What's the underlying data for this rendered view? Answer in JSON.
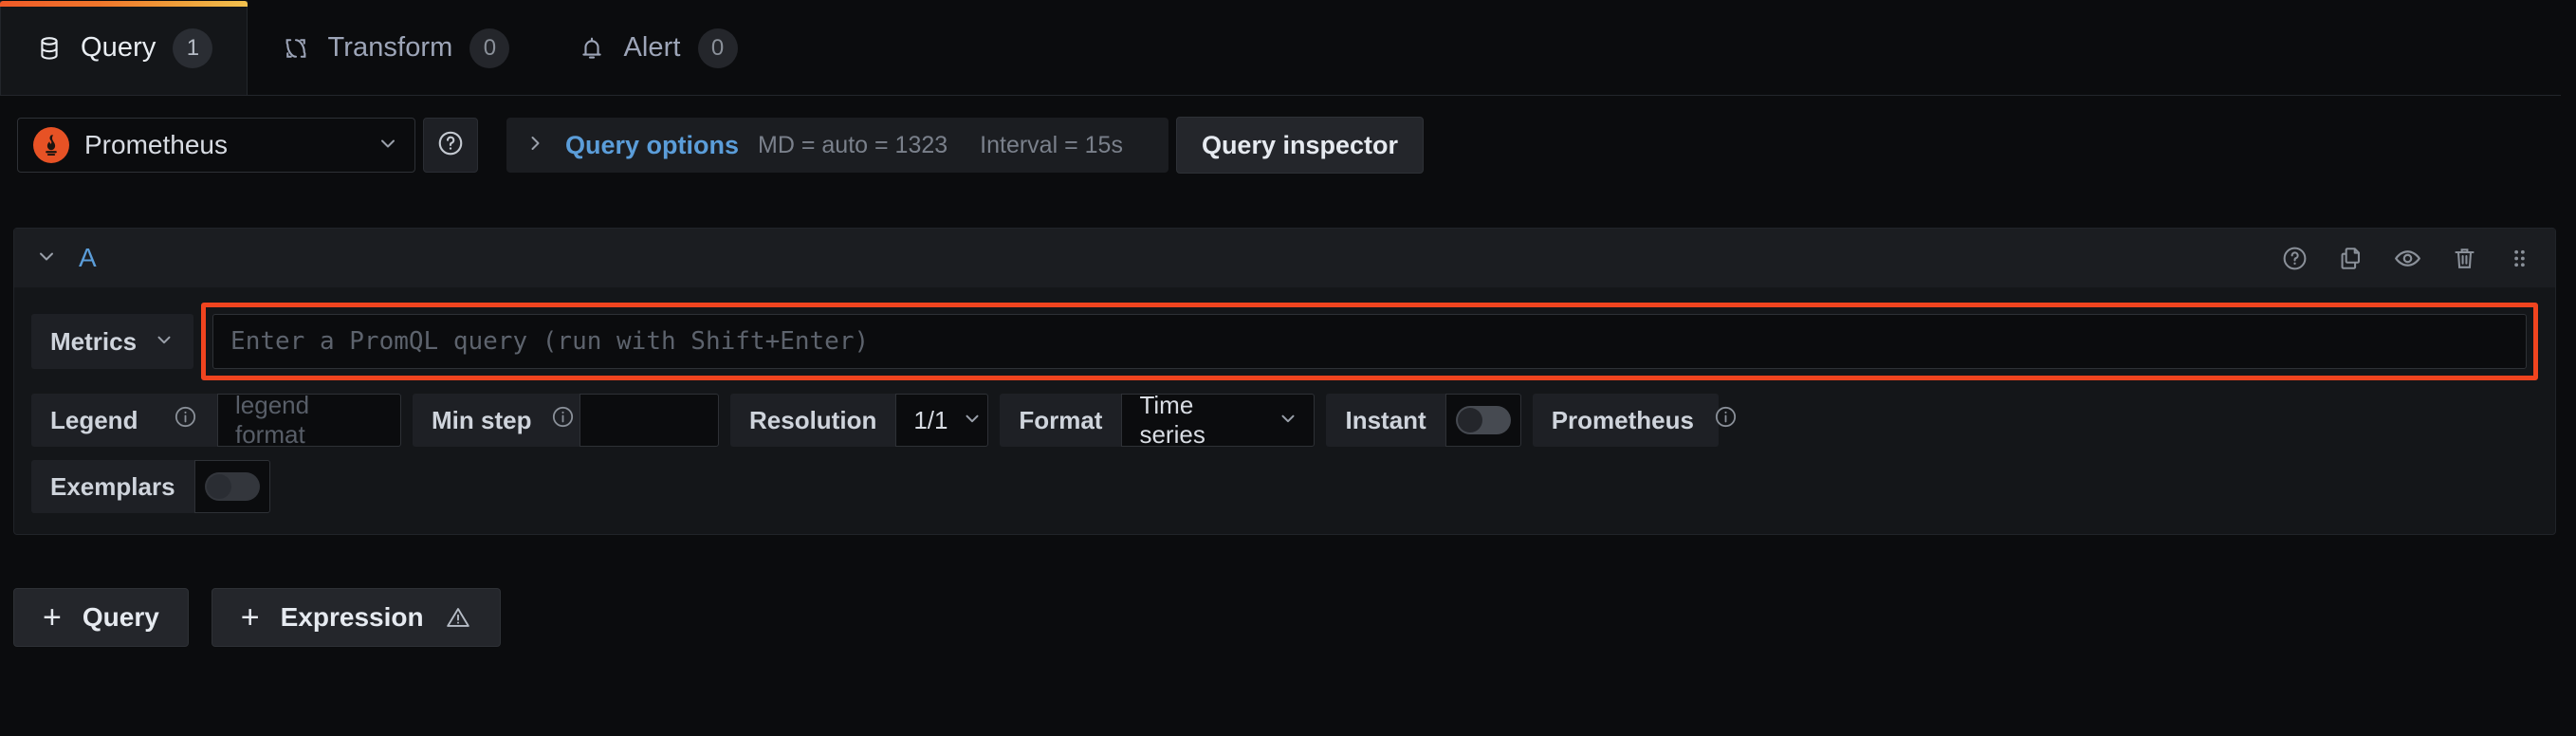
{
  "tabs": [
    {
      "label": "Query",
      "badge": "1",
      "icon": "database-icon",
      "active": true
    },
    {
      "label": "Transform",
      "badge": "0",
      "icon": "transform-icon",
      "active": false
    },
    {
      "label": "Alert",
      "badge": "0",
      "icon": "bell-icon",
      "active": false
    }
  ],
  "datasource": {
    "name": "Prometheus",
    "logo": "prometheus-logo",
    "help_icon": "help-circle-icon",
    "chevron": "chevron-down-icon"
  },
  "query_options": {
    "label": "Query options",
    "chevron": "chevron-right-icon",
    "max_data_points": "MD = auto = 1323",
    "interval": "Interval = 15s"
  },
  "query_inspector": {
    "label": "Query inspector"
  },
  "query_row": {
    "ref_id": "A",
    "collapse_icon": "chevron-down-icon",
    "actions": [
      {
        "name": "help-circle-icon",
        "title": "Show data source help"
      },
      {
        "name": "copy-icon",
        "title": "Duplicate query"
      },
      {
        "name": "eye-icon",
        "title": "Disable/enable query"
      },
      {
        "name": "trash-icon",
        "title": "Remove query"
      },
      {
        "name": "drag-handle-icon",
        "title": "Drag and drop to reorder"
      }
    ],
    "metrics_button": "Metrics",
    "promql_placeholder": "Enter a PromQL query (run with Shift+Enter)",
    "legend_label": "Legend",
    "legend_placeholder": "legend format",
    "legend_value": "",
    "min_step_label": "Min step",
    "min_step_value": "",
    "min_step_placeholder": "",
    "resolution_label": "Resolution",
    "resolution_value": "1/1",
    "format_label": "Format",
    "format_value": "Time series",
    "instant_label": "Instant",
    "instant_on": false,
    "type_label": "Prometheus",
    "exemplars_label": "Exemplars",
    "exemplars_on": false
  },
  "footer_buttons": [
    {
      "label": "Query",
      "icon": "plus-icon",
      "warning": false
    },
    {
      "label": "Expression",
      "icon": "plus-icon",
      "warning": true
    }
  ],
  "colors": {
    "accent_blue": "#5b9dd9",
    "highlight_red": "#f0441f",
    "tab_gradient_start": "#f05a28",
    "tab_gradient_end": "#f2c14e",
    "prometheus_orange": "#e75225",
    "panel_bg": "#141619",
    "page_bg": "#0b0c0e"
  }
}
